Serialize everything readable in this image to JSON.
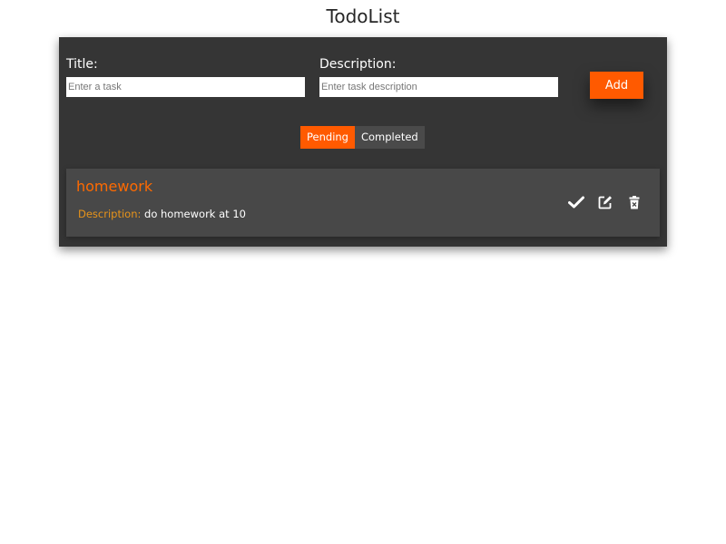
{
  "app": {
    "title": "TodoList"
  },
  "form": {
    "title_label": "Title:",
    "title_placeholder": "Enter a task",
    "title_value": "",
    "description_label": "Description:",
    "description_placeholder": "Enter task description",
    "description_value": "",
    "add_label": "Add"
  },
  "tabs": [
    {
      "label": "Pending",
      "active": true
    },
    {
      "label": "Completed",
      "active": false
    }
  ],
  "todos": [
    {
      "title": "homework",
      "description_label": "Description:",
      "description": "do homework at 10",
      "actions": [
        "check-icon",
        "edit-icon",
        "delete-icon"
      ]
    }
  ],
  "colors": {
    "accent": "#ff5a00",
    "panel": "#353535",
    "item": "#484848",
    "description_label": "#e8941a"
  }
}
